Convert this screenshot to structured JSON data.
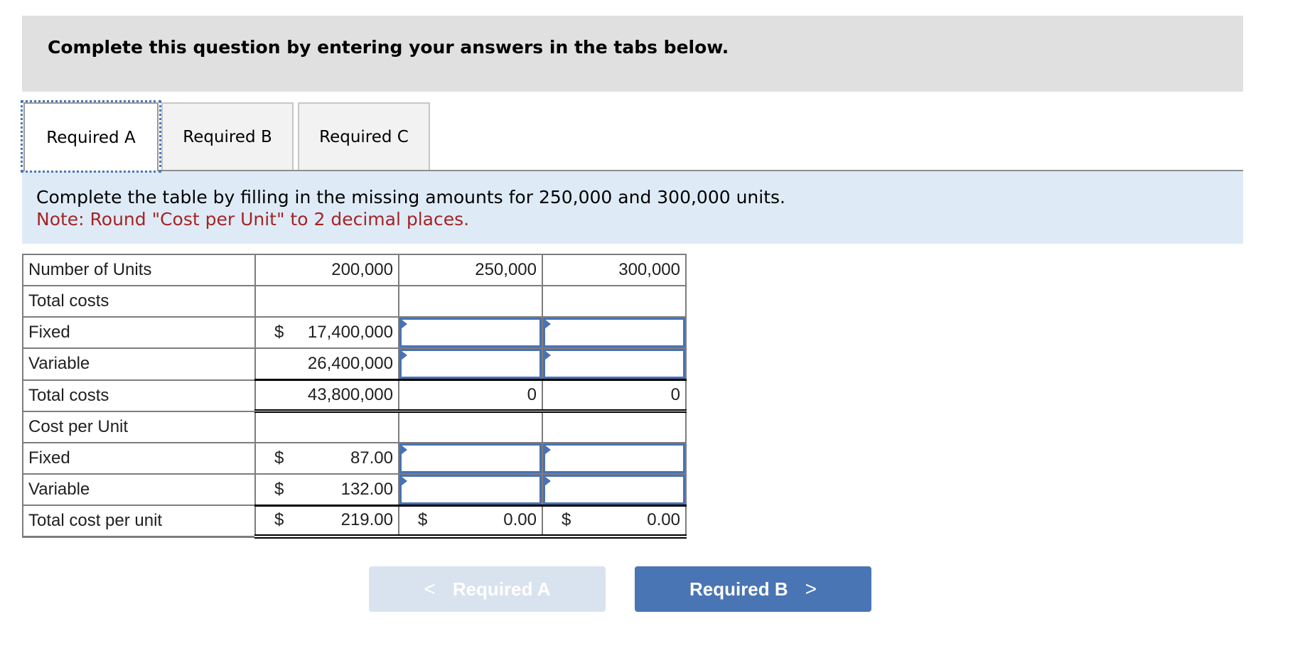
{
  "header": {
    "title": "Complete this question by entering your answers in the tabs below."
  },
  "tabs": [
    {
      "label": "Required A",
      "active": true
    },
    {
      "label": "Required B",
      "active": false
    },
    {
      "label": "Required C",
      "active": false
    }
  ],
  "instructions": {
    "line1": "Complete the table by filling in the missing amounts for 250,000 and 300,000 units.",
    "note": "Note: Round \"Cost per Unit\" to 2 decimal places."
  },
  "table": {
    "header": {
      "label": "Number of Units",
      "cols": [
        "200,000",
        "250,000",
        "300,000"
      ]
    },
    "rows": {
      "total_costs_heading": {
        "label": "Total costs"
      },
      "fixed": {
        "label": "Fixed",
        "dollar": "$",
        "value_200k": "17,400,000",
        "input_250k": "",
        "input_300k": ""
      },
      "variable": {
        "label": "Variable",
        "value_200k": "26,400,000",
        "input_250k": "",
        "input_300k": ""
      },
      "total_costs": {
        "label": "Total costs",
        "value_200k": "43,800,000",
        "value_250k": "0",
        "value_300k": "0"
      },
      "cost_per_unit_heading": {
        "label": "Cost per Unit"
      },
      "fixed_per_unit": {
        "label": "Fixed",
        "dollar": "$",
        "value_200k": "87.00",
        "input_250k": "",
        "input_300k": ""
      },
      "variable_per_unit": {
        "label": "Variable",
        "dollar": "$",
        "value_200k": "132.00",
        "input_250k": "",
        "input_300k": ""
      },
      "total_per_unit": {
        "label": "Total cost per unit",
        "dollar": "$",
        "value_200k": "219.00",
        "value_250k": "0.00",
        "value_300k": "0.00"
      }
    }
  },
  "nav": {
    "prev": {
      "label": "Required A",
      "icon": "chevron-left-icon",
      "glyph": "<",
      "disabled": true
    },
    "next": {
      "label": "Required B",
      "icon": "chevron-right-icon",
      "glyph": ">"
    }
  },
  "colors": {
    "accent": "#4a75b4",
    "note_red": "#a52424",
    "instruction_bg": "#deebf7",
    "header_bg": "#e0e0e0"
  }
}
